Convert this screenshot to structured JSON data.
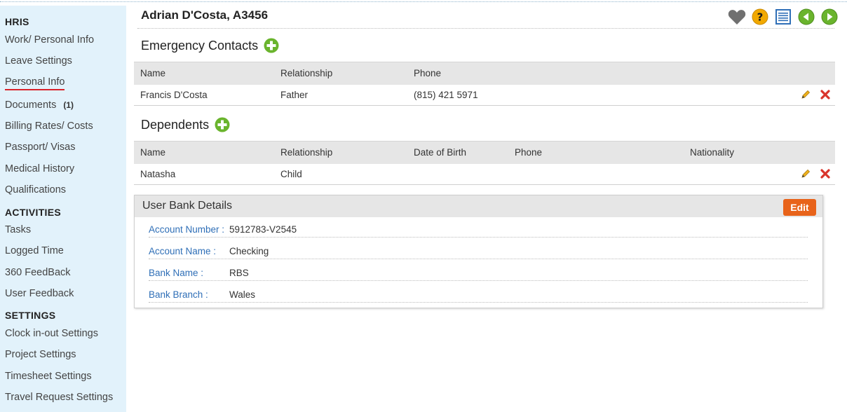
{
  "sidebar": {
    "sections": [
      {
        "heading": "HRIS",
        "items": [
          {
            "label": "Work/ Personal Info"
          },
          {
            "label": "Leave Settings"
          },
          {
            "label": "Personal Info",
            "active": true
          },
          {
            "label": "Documents",
            "count": "(1)"
          },
          {
            "label": "Billing Rates/ Costs"
          },
          {
            "label": "Passport/ Visas"
          },
          {
            "label": "Medical History"
          },
          {
            "label": "Qualifications"
          }
        ]
      },
      {
        "heading": "ACTIVITIES",
        "items": [
          {
            "label": "Tasks"
          },
          {
            "label": "Logged Time"
          },
          {
            "label": "360 FeedBack"
          },
          {
            "label": "User Feedback"
          }
        ]
      },
      {
        "heading": "SETTINGS",
        "items": [
          {
            "label": "Clock in-out Settings"
          },
          {
            "label": "Project Settings"
          },
          {
            "label": "Timesheet Settings"
          },
          {
            "label": "Travel Request Settings"
          }
        ]
      }
    ]
  },
  "header": {
    "title": "Adrian D'Costa, A3456",
    "icons": [
      "heart-icon",
      "help-icon",
      "list-icon",
      "prev-icon",
      "next-icon"
    ]
  },
  "emergency": {
    "title": "Emergency Contacts",
    "columns": [
      "Name",
      "Relationship",
      "Phone"
    ],
    "rows": [
      {
        "name": "Francis D'Costa",
        "relationship": "Father",
        "phone": "(815) 421 5971"
      }
    ]
  },
  "dependents": {
    "title": "Dependents",
    "columns": [
      "Name",
      "Relationship",
      "Date of Birth",
      "Phone",
      "Nationality"
    ],
    "rows": [
      {
        "name": "Natasha",
        "relationship": "Child",
        "dob": "",
        "phone": "",
        "nationality": ""
      }
    ]
  },
  "bank": {
    "title": "User Bank Details",
    "edit_label": "Edit",
    "fields": [
      {
        "label": "Account Number :",
        "value": "5912783-V2545"
      },
      {
        "label": "Account Name :",
        "value": "Checking"
      },
      {
        "label": "Bank Name :",
        "value": "RBS"
      },
      {
        "label": "Bank Branch :",
        "value": "Wales"
      }
    ]
  },
  "colors": {
    "accent_green": "#6ab42d",
    "edit_orange": "#e8631a",
    "link_blue": "#2f6fb7",
    "sidebar_bg": "#e2f2fb",
    "delete_red": "#d9342b"
  }
}
